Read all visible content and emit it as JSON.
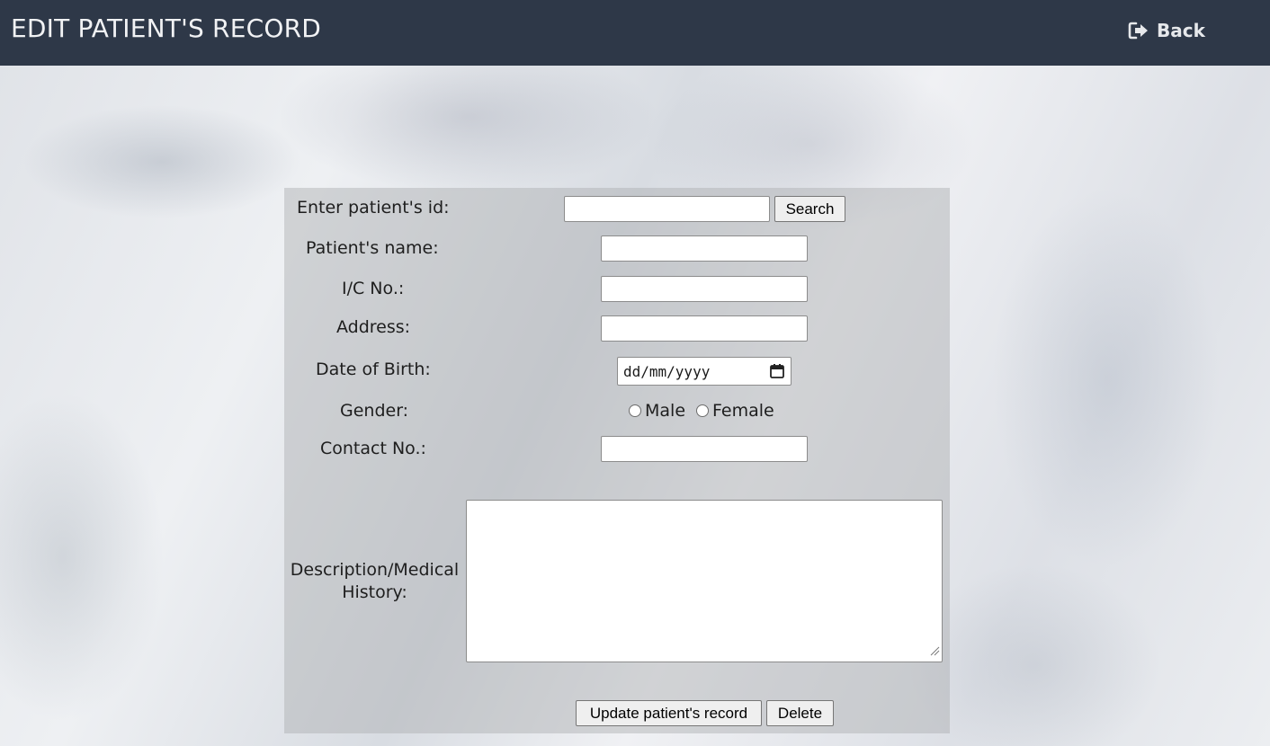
{
  "header": {
    "title": "EDIT PATIENT'S RECORD",
    "back_label": "Back",
    "back_icon": "sign-out-icon"
  },
  "form": {
    "search_label": "Enter patient's id:",
    "search_value": "",
    "search_button": "Search",
    "name_label": "Patient's name:",
    "name_value": "",
    "ic_label": "I/C No.:",
    "ic_value": "",
    "address_label": "Address:",
    "address_value": "",
    "dob_label": "Date of Birth:",
    "dob_placeholder": "dd/mm/yyyy",
    "gender_label": "Gender:",
    "gender_options": [
      "Male",
      "Female"
    ],
    "contact_label": "Contact No.:",
    "contact_value": "",
    "description_label_line1": "Description/Medical",
    "description_label_line2": "History:",
    "description_value": "",
    "update_button": "Update patient's record",
    "delete_button": "Delete"
  },
  "colors": {
    "navbar": "#2e3848",
    "panel": "rgba(170,172,176,0.45)",
    "text": "#1e1e1e"
  }
}
